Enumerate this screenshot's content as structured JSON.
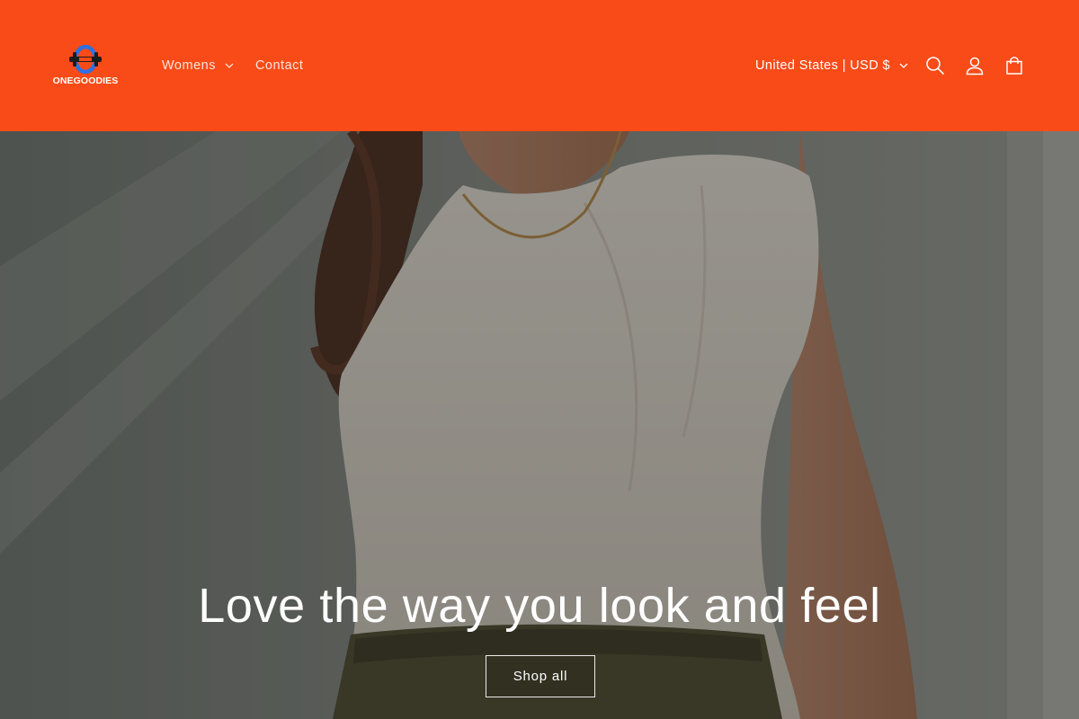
{
  "brand": {
    "name": "ONEGOODIES",
    "colors": {
      "header": "#f84b17",
      "logo_blue": "#2f6fe0",
      "logo_dark": "#1c1c1c"
    }
  },
  "nav": {
    "items": [
      {
        "label": "Womens",
        "has_dropdown": true
      },
      {
        "label": "Contact",
        "has_dropdown": false
      }
    ]
  },
  "header": {
    "locale_label": "United States | USD $",
    "icons": [
      "search-icon",
      "account-icon",
      "cart-icon"
    ]
  },
  "hero": {
    "title": "Love the way you look and feel",
    "button_label": "Shop all"
  }
}
